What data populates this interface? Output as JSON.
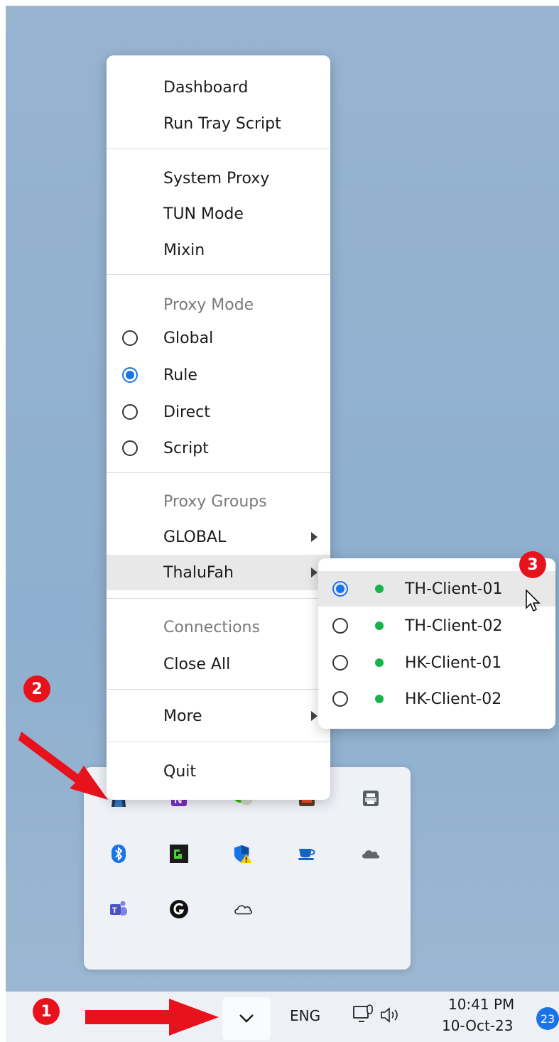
{
  "menu": {
    "items": {
      "dashboard": "Dashboard",
      "run_tray_script": "Run Tray Script",
      "system_proxy": "System Proxy",
      "tun_mode": "TUN Mode",
      "mixin": "Mixin",
      "proxy_mode_header": "Proxy Mode",
      "global": "Global",
      "rule": "Rule",
      "direct": "Direct",
      "script": "Script",
      "proxy_groups_header": "Proxy Groups",
      "group_global": "GLOBAL",
      "group_thalufah": "ThaluFah",
      "connections_header": "Connections",
      "close_all": "Close All",
      "more": "More",
      "quit": "Quit"
    },
    "selected_proxy_mode": "Rule"
  },
  "submenu": {
    "items": [
      {
        "label": "TH-Client-01",
        "selected": true,
        "status_color": "#16b34a"
      },
      {
        "label": "TH-Client-02",
        "selected": false,
        "status_color": "#16b34a"
      },
      {
        "label": "HK-Client-01",
        "selected": false,
        "status_color": "#16b34a"
      },
      {
        "label": "HK-Client-02",
        "selected": false,
        "status_color": "#16b34a"
      }
    ]
  },
  "annotations": {
    "badge1": "1",
    "badge2": "2",
    "badge3": "3"
  },
  "taskbar": {
    "language": "ENG",
    "time": "10:41 PM",
    "date": "10-Oct-23",
    "notification_count": "23"
  },
  "tray_icons": [
    "clash-icon",
    "onenote-icon",
    "wechat-icon",
    "app-grid-icon",
    "printer-icon",
    "bluetooth-icon",
    "terminal-app-icon",
    "defender-icon",
    "teacup-icon",
    "cloud-dark-icon",
    "teams-icon",
    "g-app-icon",
    "onedrive-icon"
  ],
  "colors": {
    "accent": "#1a73e8",
    "status_online": "#16b34a",
    "annotation_red": "#e8121c"
  }
}
